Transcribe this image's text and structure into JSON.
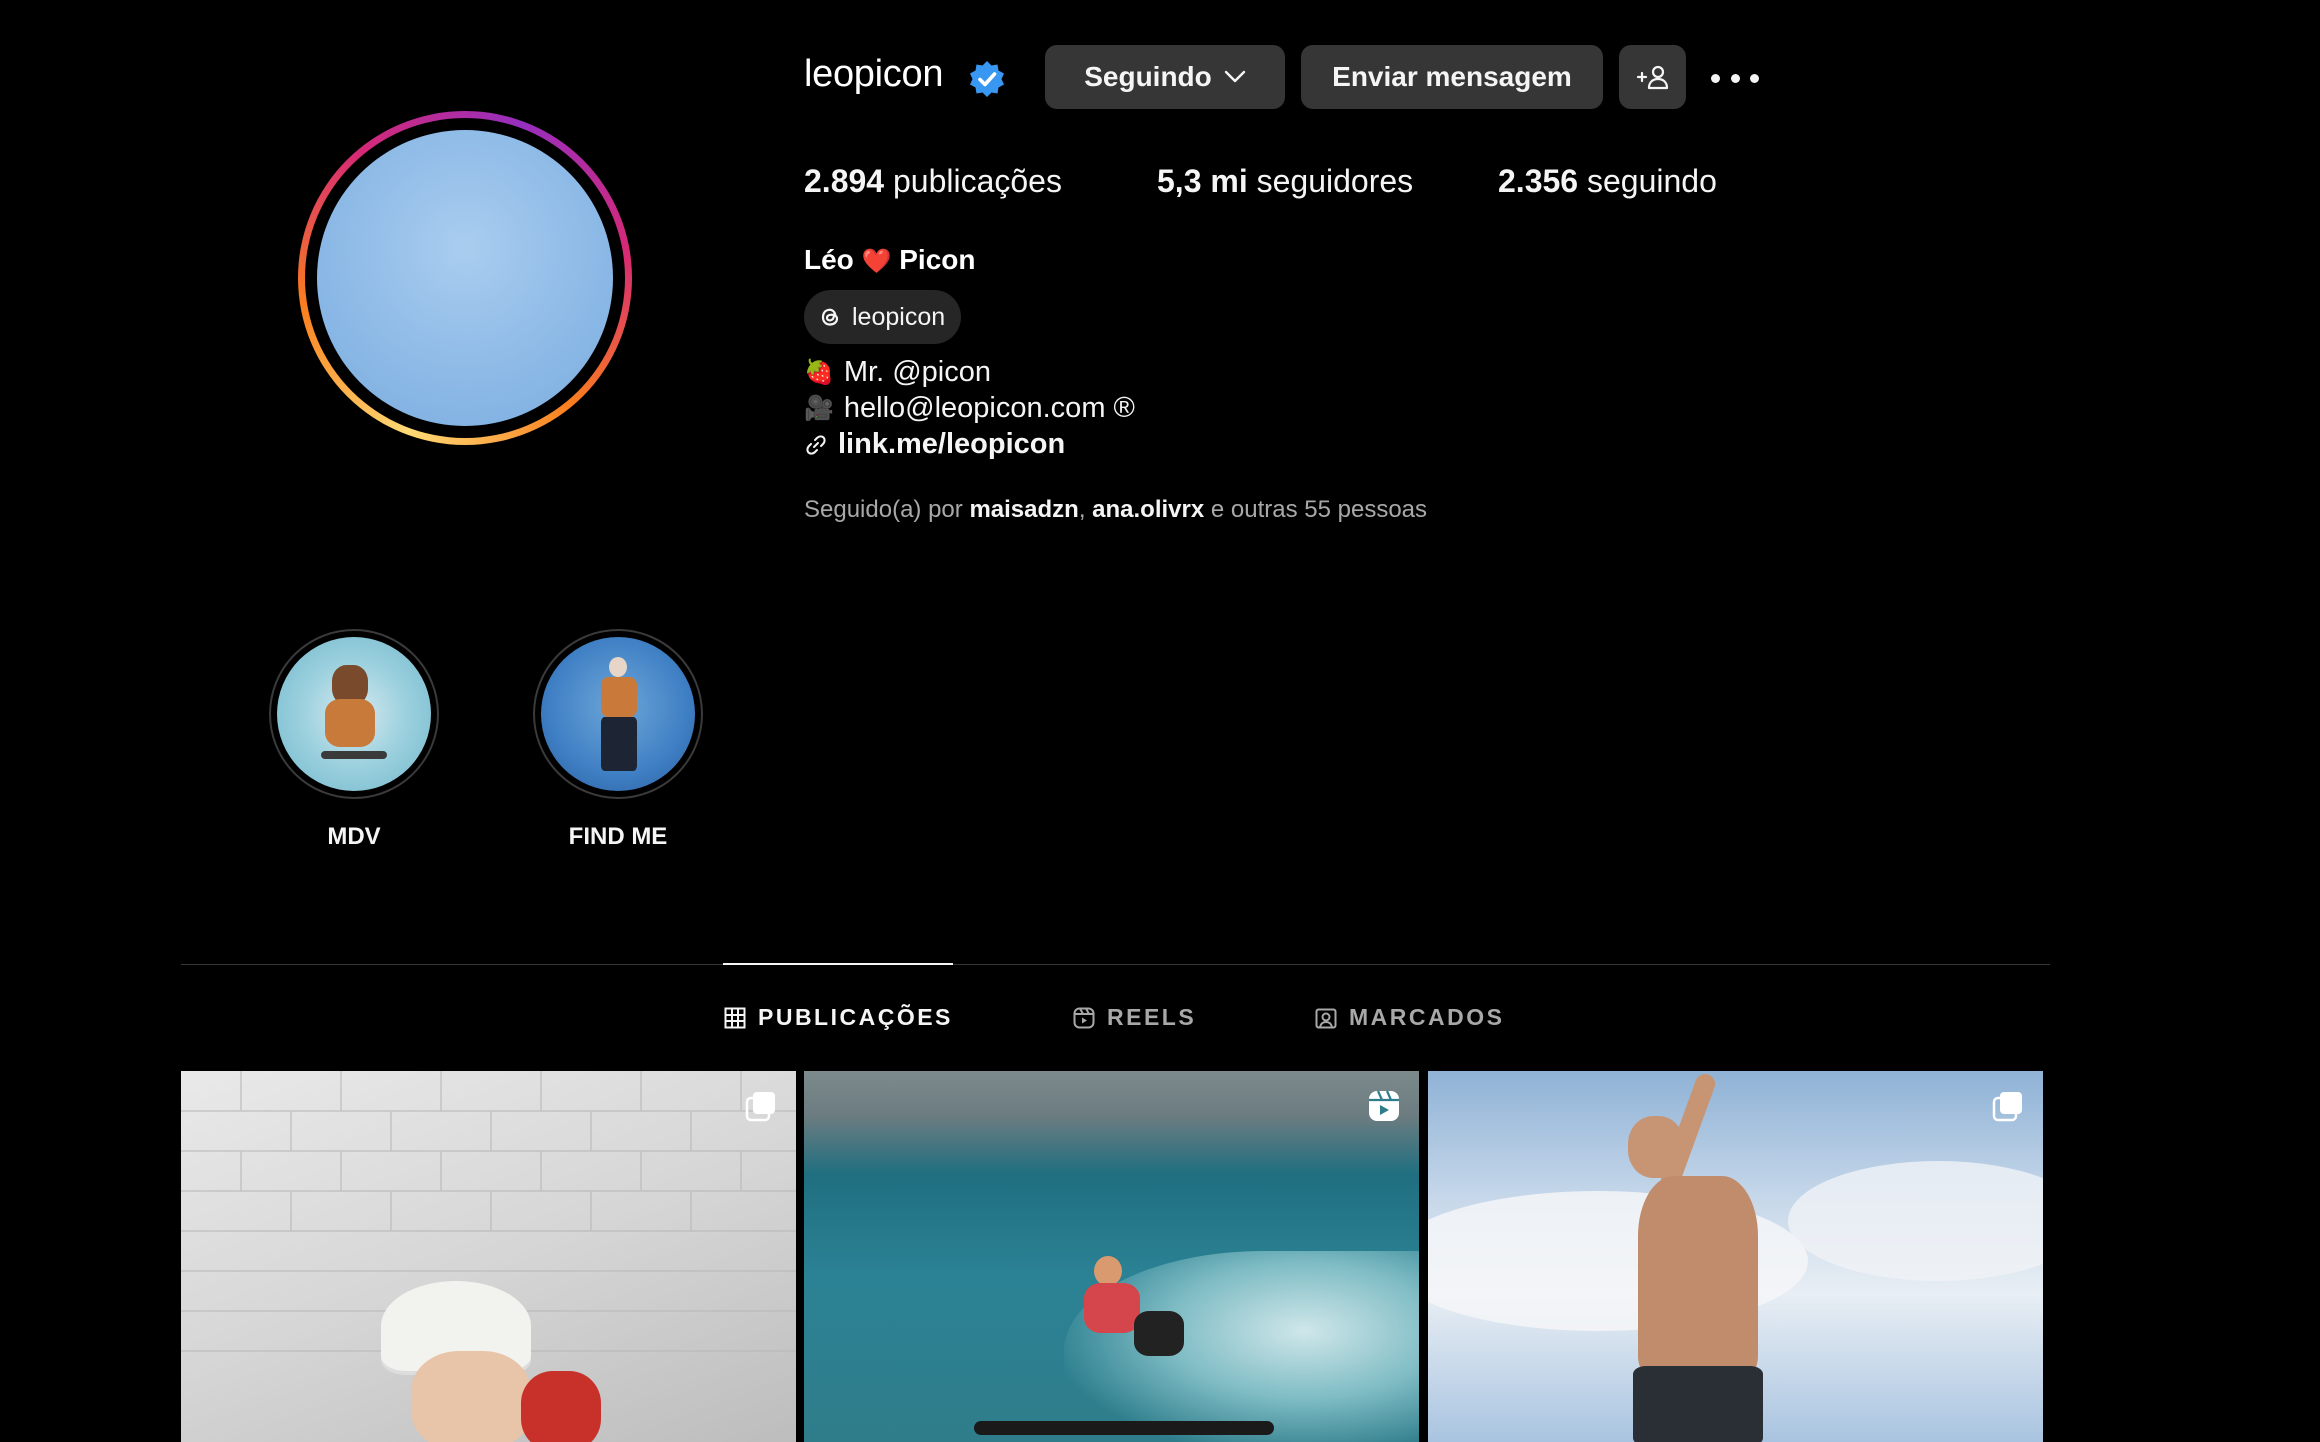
{
  "profile": {
    "username": "leopicon",
    "full_name_first": "Léo",
    "full_name_heart": "❤️",
    "full_name_last": "Picon",
    "threads_handle": "leopicon",
    "bio": [
      {
        "emoji": "🍓",
        "text": "Mr. @picon"
      },
      {
        "emoji": "🎥",
        "text": "hello@leopicon.com ®"
      }
    ],
    "link": "link.me/leopicon",
    "followed_by_prefix": "Seguido(a) por",
    "followed_by_user1": "maisadzn",
    "followed_by_sep": ",",
    "followed_by_user2": "ana.olivrx",
    "followed_by_suffix": "e outras 55 pessoas"
  },
  "actions": {
    "follow_label": "Seguindo",
    "message_label": "Enviar mensagem"
  },
  "stats": [
    {
      "value": "2.894",
      "label": "publicações"
    },
    {
      "value": "5,3 mi",
      "label": "seguidores"
    },
    {
      "value": "2.356",
      "label": "seguindo"
    }
  ],
  "highlights": [
    {
      "label": "MDV"
    },
    {
      "label": "FIND ME"
    }
  ],
  "tabs": [
    {
      "label": "PUBLICAÇÕES",
      "active": true,
      "icon": "grid-icon"
    },
    {
      "label": "REELS",
      "active": false,
      "icon": "reels-icon"
    },
    {
      "label": "MARCADOS",
      "active": false,
      "icon": "tagged-icon"
    }
  ],
  "posts": [
    {
      "type": "carousel",
      "icon": "carousel-icon"
    },
    {
      "type": "reel",
      "icon": "reel-icon"
    },
    {
      "type": "carousel",
      "icon": "carousel-icon"
    }
  ],
  "colors": {
    "background": "#000000",
    "button": "#363636",
    "verified": "#3897f0",
    "muted_text": "#a8a8a8"
  }
}
